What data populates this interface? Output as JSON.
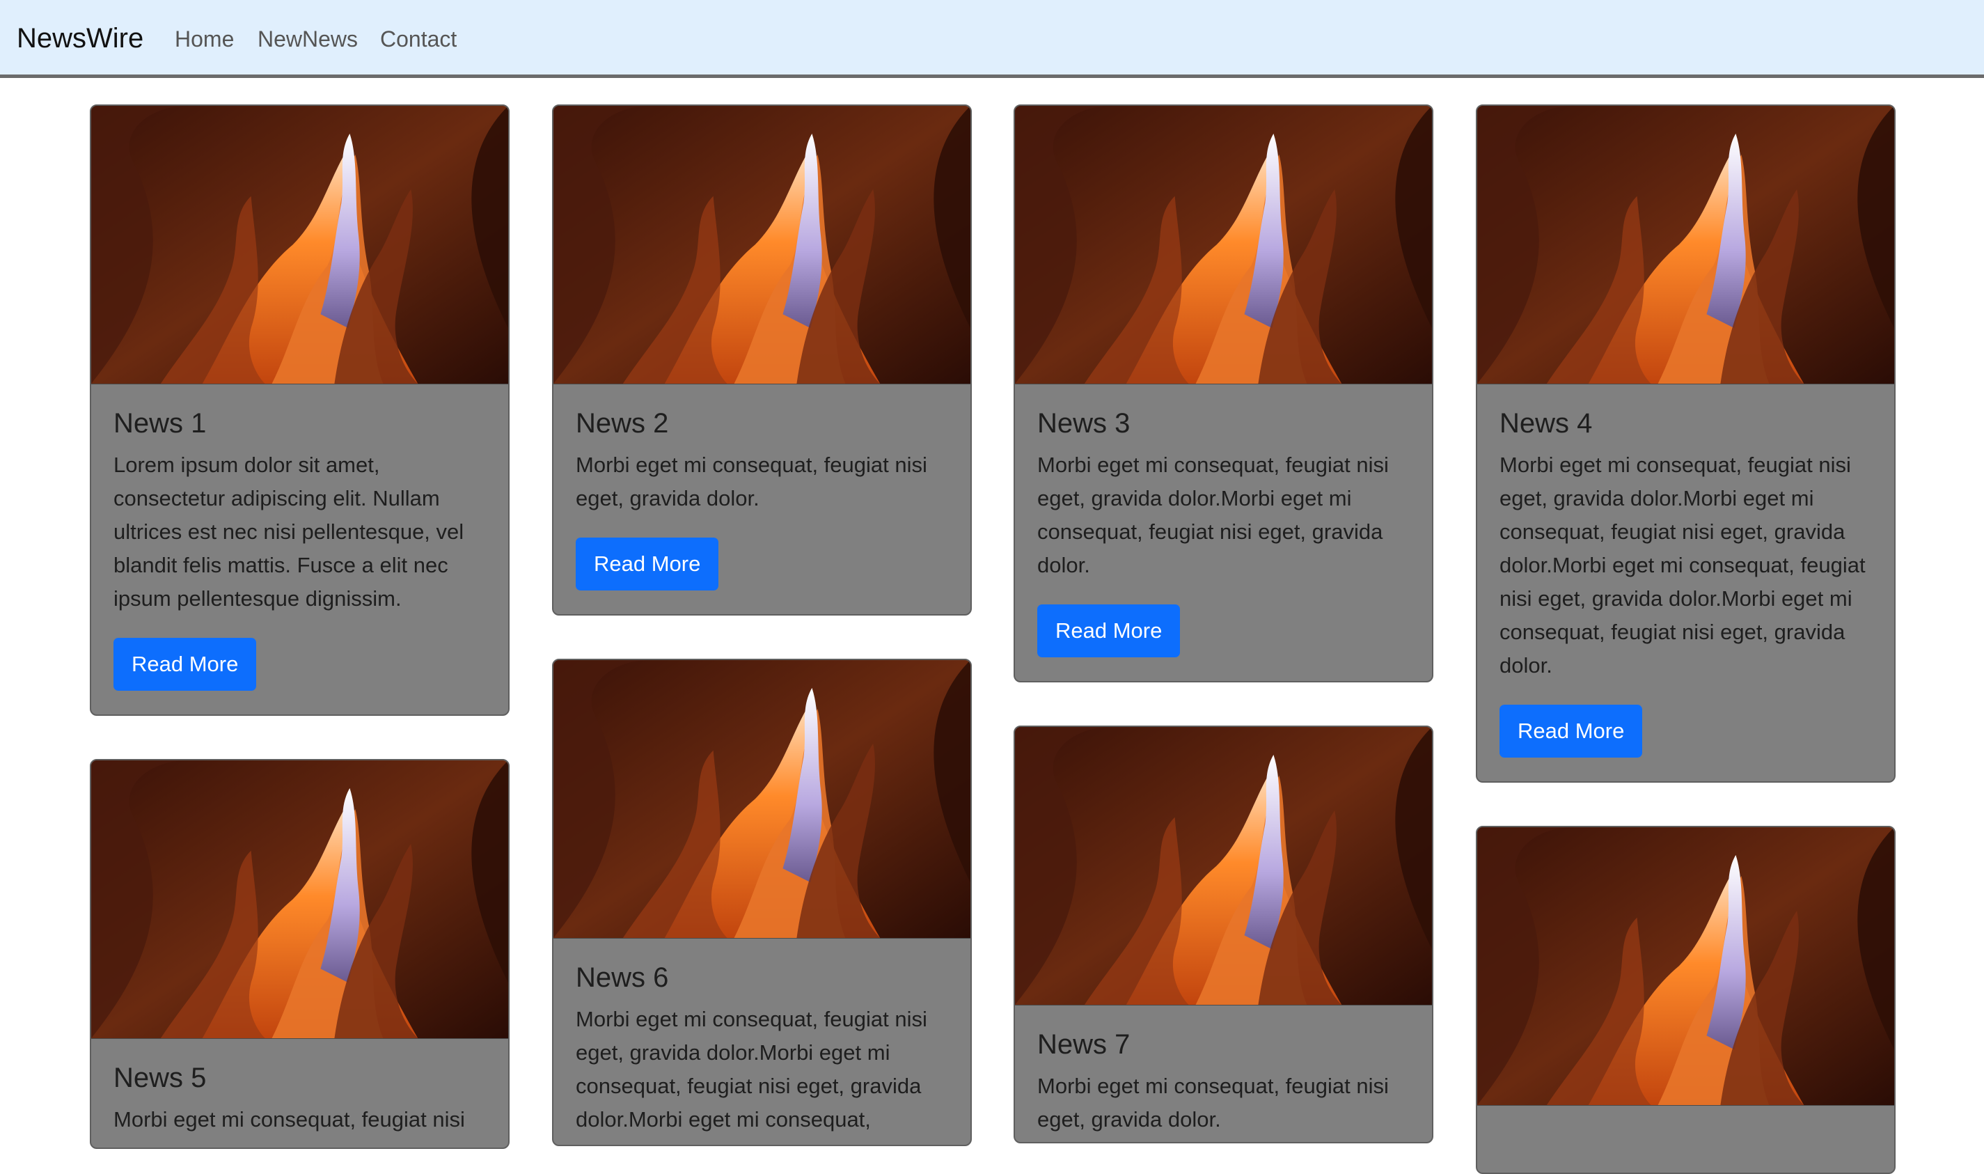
{
  "navbar": {
    "brand": "NewsWire",
    "links": [
      "Home",
      "NewNews",
      "Contact"
    ]
  },
  "cards": [
    {
      "title": "News 1",
      "text": "Lorem ipsum dolor sit amet, consectetur adipiscing elit. Nullam ultrices est nec nisi pellentesque, vel blandit felis mattis. Fusce a elit nec ipsum pellentesque dignissim.",
      "button": "Read More"
    },
    {
      "title": "News 2",
      "text": "Morbi eget mi consequat, feugiat nisi eget, gravida dolor.",
      "button": "Read More"
    },
    {
      "title": "News 3",
      "text": "Morbi eget mi consequat, feugiat nisi eget, gravida dolor.Morbi eget mi consequat, feugiat nisi eget, gravida dolor.",
      "button": "Read More"
    },
    {
      "title": "News 4",
      "text": "Morbi eget mi consequat, feugiat nisi eget, gravida dolor.Morbi eget mi consequat, feugiat nisi eget, gravida dolor.Morbi eget mi consequat, feugiat nisi eget, gravida dolor.Morbi eget mi consequat, feugiat nisi eget, gravida dolor.",
      "button": "Read More"
    },
    {
      "title": "News 5",
      "text": "Morbi eget mi consequat, feugiat nisi"
    },
    {
      "title": "News 6",
      "text": "Morbi eget mi consequat, feugiat nisi eget, gravida dolor.Morbi eget mi consequat, feugiat nisi eget, gravida dolor.Morbi eget mi consequat,"
    },
    {
      "title": "News 7",
      "text": "Morbi eget mi consequat, feugiat nisi eget, gravida dolor."
    },
    {
      "title": "",
      "text": ""
    }
  ],
  "colors": {
    "navbar_bg": "#e0effd",
    "card_bg": "#808080",
    "button_bg": "#0d6efd"
  }
}
